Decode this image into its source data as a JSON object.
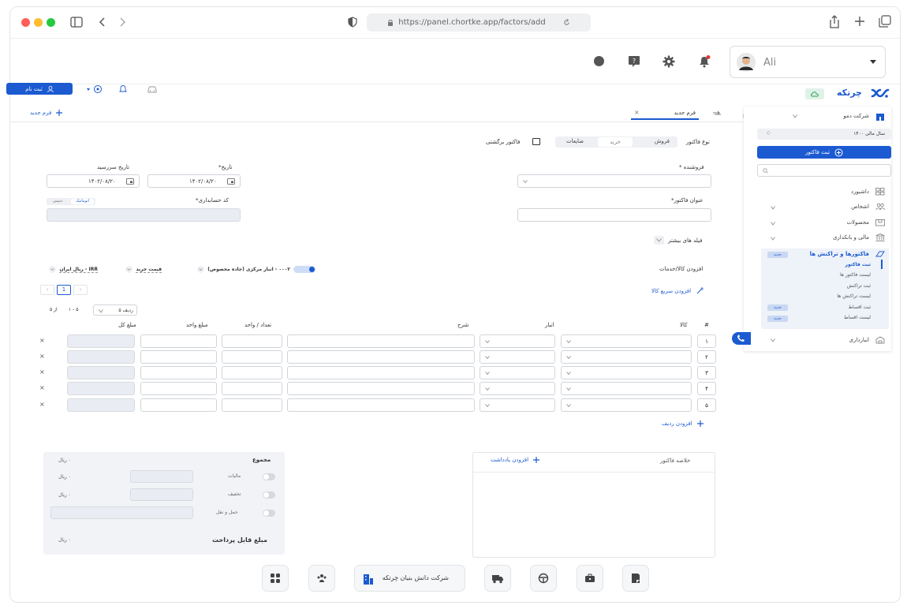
{
  "browser": {
    "url": "https://panel.chortke.app/factors/add"
  },
  "header": {
    "user_name": "Ali"
  },
  "appbar": {
    "brand": "چرتکه",
    "register_label": "ثبت نام"
  },
  "tabs": {
    "active_tab": "فرم جدید",
    "new_form_link": "فرم جدید"
  },
  "form": {
    "invoice_type_label": "نوع فاکتور",
    "type_options": [
      "فروش",
      "خرید",
      "ضایعات"
    ],
    "type_selected": "خرید",
    "return_invoice_label": "فاکتور برگشتی",
    "seller_label": "فروشنده *",
    "date_label": "تاریخ*",
    "date_value": "۱۴۰۲/۰۸/۲۰",
    "due_date_label": "تاریخ سررسید",
    "due_date_value": "۱۴۰۲/۰۸/۲۰",
    "invoice_title_label": "عنوان فاکتور*",
    "accounting_code_label": "کد حسابداری*",
    "code_modes": [
      "اتوماتیک",
      "دستی"
    ],
    "more_fields_label": "فیلد های بیشتر"
  },
  "items": {
    "section_label": "افزودن کالا/خدمات",
    "warehouse_chip": "۰۰۰۲ - انبار مرکزی (جاده مخصوص)",
    "price_chip": "قیمت خرید",
    "currency_chip": "IRR - ریال ایران",
    "pagination_current": "1",
    "quick_add_label": "افزودن سریع کالا",
    "rows_per_page": "۵ ردیف",
    "range_text": "۱ - ۵",
    "of_text": "از ۵",
    "columns": [
      "#",
      "کالا",
      "انبار",
      "شرح",
      "تعداد / واحد",
      "مبلغ واحد",
      "مبلغ کل"
    ],
    "row_numbers": [
      "۱",
      "۲",
      "۳",
      "۴",
      "۵"
    ],
    "add_row_label": "افزودن ردیف"
  },
  "summary": {
    "invoice_summary_label": "خلاصه فاکتور",
    "add_note_label": "افزودن یادداشت",
    "total_label": "مجموع",
    "total_value": "۰ ریال",
    "tax_label": "مالیات",
    "tax_value": "۰ ریال",
    "discount_label": "تخفیف",
    "discount_value": "۰ ریال",
    "shipping_label": "حمل و نقل",
    "payable_label": "مبلغ قابل پرداخت",
    "payable_value": "۰ ریال"
  },
  "sidebar": {
    "company": "شرکت دمو",
    "fiscal_year": "سال مالی ۱۴۰۰",
    "new_invoice_button": "ثبت فاکتور",
    "menu": [
      "داشبورد",
      "اشخاص",
      "محصولات",
      "مالی و بانکداری",
      "فاکتورها و تراکنش ها",
      "انبارداری"
    ],
    "new_badge": "جدید",
    "submenu": [
      "ثبت فاکتور",
      "لیست فاکتور ها",
      "ثبت تراکنش",
      "لیست تراکنش ها",
      "ثبت اقساط",
      "لیست اقساط"
    ]
  },
  "dock": {
    "company_label": "شرکت دانش بنیان چرتکه"
  },
  "colors": {
    "accent": "#1b5ad1",
    "sidebar_highlight": "#eef2f9",
    "notification_dot": "#e53935"
  }
}
